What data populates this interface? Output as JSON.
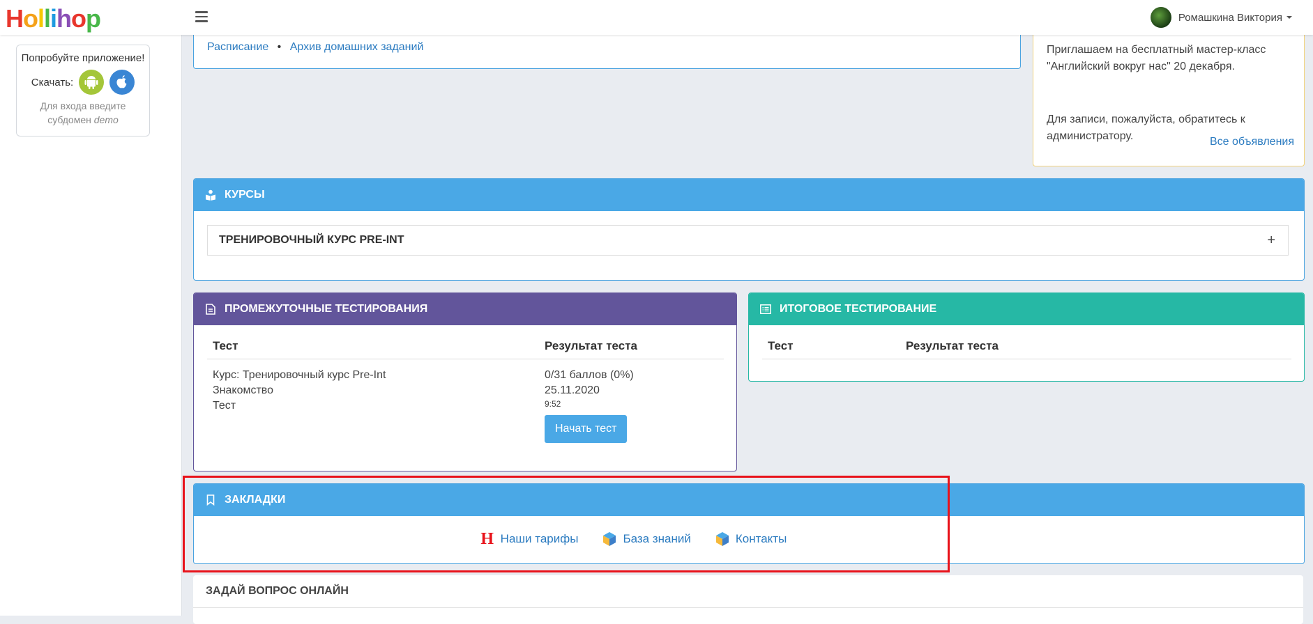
{
  "header": {
    "logo_text": "Hollihop",
    "user_name": "Ромашкина Виктория"
  },
  "sidebar": {
    "try_app": "Попробуйте приложение!",
    "download_label": "Скачать:",
    "hint_line1": "Для входа введите",
    "hint_line2_prefix": "субдомен ",
    "hint_subdomain": "demo"
  },
  "links_bar": {
    "schedule": "Расписание",
    "separator": "•",
    "homework_archive": "Архив домашних заданий"
  },
  "announcement": {
    "text1": "Приглашаем на бесплатный мастер-класс \"Английский вокруг нас\" 20 декабря.",
    "text2": "Для записи, пожалуйста, обратитесь к администратору.",
    "all_link": "Все объявления",
    "accent_color": "#f1d27a"
  },
  "courses": {
    "title": "КУРСЫ",
    "items": [
      {
        "name": "ТРЕНИРОВОЧНЫЙ КУРС PRE-INT",
        "toggle": "+"
      }
    ]
  },
  "interim_tests": {
    "title": "ПРОМЕЖУТОЧНЫЕ ТЕСТИРОВАНИЯ",
    "col_test": "Тест",
    "col_result": "Результат теста",
    "rows": [
      {
        "line1": "Курс: Тренировочный курс Pre-Int",
        "line2": "Знакомство",
        "line3": "Тест",
        "score": "0/31 баллов (0%)",
        "date": "25.11.2020",
        "time": "9:52",
        "button": "Начать тест"
      }
    ]
  },
  "final_tests": {
    "title": "ИТОГОВОЕ ТЕСТИРОВАНИЕ",
    "col_test": "Тест",
    "col_result": "Результат теста"
  },
  "bookmarks": {
    "title": "ЗАКЛАДКИ",
    "items": [
      {
        "label": "Наши тарифы",
        "icon": "hollihop-h-icon"
      },
      {
        "label": "База знаний",
        "icon": "cube-icon"
      },
      {
        "label": "Контакты",
        "icon": "cube-icon"
      }
    ]
  },
  "ask_online": {
    "title": "ЗАДАЙ ВОПРОС ОНЛАЙН"
  },
  "colors": {
    "blue_header": "#4aa8e6",
    "purple_header": "#62559b",
    "teal_header": "#26b8a5",
    "highlight_box": "#e8121a"
  }
}
